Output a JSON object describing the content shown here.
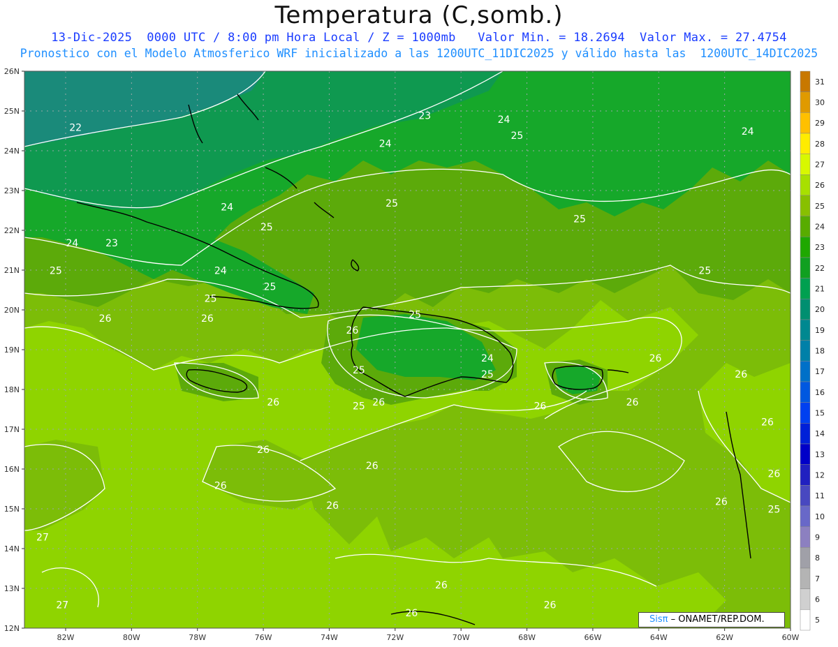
{
  "header": {
    "title": "Temperatura (C,somb.)",
    "line1": "13-Dic-2025  0000 UTC / 8:00 pm Hora Local / Z = 1000mb   Valor Min. = 18.2694  Valor Max. = 27.4754",
    "line2": "Pronostico con el Modelo Atmosferico WRF inicializado a las 1200UTC_11DIC2025 y válido hasta las  1200UTC_14DIC2025"
  },
  "map": {
    "lat_labels": [
      "26N",
      "25N",
      "24N",
      "23N",
      "22N",
      "21N",
      "20N",
      "19N",
      "18N",
      "17N",
      "16N",
      "15N",
      "14N",
      "13N",
      "12N"
    ],
    "lon_labels": [
      "82W",
      "80W",
      "78W",
      "76W",
      "74W",
      "72W",
      "70W",
      "68W",
      "66W",
      "64W",
      "62W",
      "60W"
    ],
    "contour_labels": [
      {
        "text": "23",
        "lon": -71.1,
        "lat": 24.8
      },
      {
        "text": "22",
        "lon": -81.7,
        "lat": 24.5
      },
      {
        "text": "24",
        "lon": -72.3,
        "lat": 24.1
      },
      {
        "text": "24",
        "lon": -68.7,
        "lat": 24.7
      },
      {
        "text": "25",
        "lon": -68.3,
        "lat": 24.3
      },
      {
        "text": "24",
        "lon": -61.3,
        "lat": 24.4
      },
      {
        "text": "24",
        "lon": -77.1,
        "lat": 22.5
      },
      {
        "text": "25",
        "lon": -72.1,
        "lat": 22.6
      },
      {
        "text": "25",
        "lon": -75.9,
        "lat": 22.0
      },
      {
        "text": "25",
        "lon": -66.4,
        "lat": 22.2
      },
      {
        "text": "24",
        "lon": -81.8,
        "lat": 21.6
      },
      {
        "text": "23",
        "lon": -80.6,
        "lat": 21.6
      },
      {
        "text": "24",
        "lon": -77.3,
        "lat": 20.9
      },
      {
        "text": "25",
        "lon": -82.3,
        "lat": 20.9
      },
      {
        "text": "25",
        "lon": -62.6,
        "lat": 20.9
      },
      {
        "text": "25",
        "lon": -75.8,
        "lat": 20.5
      },
      {
        "text": "25",
        "lon": -77.6,
        "lat": 20.2
      },
      {
        "text": "26",
        "lon": -80.8,
        "lat": 19.7
      },
      {
        "text": "26",
        "lon": -77.7,
        "lat": 19.7
      },
      {
        "text": "25",
        "lon": -71.4,
        "lat": 19.8
      },
      {
        "text": "26",
        "lon": -73.3,
        "lat": 19.4
      },
      {
        "text": "24",
        "lon": -69.2,
        "lat": 18.7
      },
      {
        "text": "25",
        "lon": -73.1,
        "lat": 18.4
      },
      {
        "text": "25",
        "lon": -69.2,
        "lat": 18.3
      },
      {
        "text": "26",
        "lon": -64.1,
        "lat": 18.7
      },
      {
        "text": "26",
        "lon": -61.5,
        "lat": 18.3
      },
      {
        "text": "26",
        "lon": -75.7,
        "lat": 17.6
      },
      {
        "text": "25",
        "lon": -73.1,
        "lat": 17.5
      },
      {
        "text": "26",
        "lon": -72.5,
        "lat": 17.6
      },
      {
        "text": "26",
        "lon": -67.6,
        "lat": 17.5
      },
      {
        "text": "26",
        "lon": -64.8,
        "lat": 17.6
      },
      {
        "text": "26",
        "lon": -60.7,
        "lat": 17.1
      },
      {
        "text": "26",
        "lon": -76.0,
        "lat": 16.4
      },
      {
        "text": "26",
        "lon": -72.7,
        "lat": 16.0
      },
      {
        "text": "26",
        "lon": -60.5,
        "lat": 15.8
      },
      {
        "text": "26",
        "lon": -77.3,
        "lat": 15.5
      },
      {
        "text": "26",
        "lon": -73.9,
        "lat": 15.0
      },
      {
        "text": "26",
        "lon": -62.1,
        "lat": 15.1
      },
      {
        "text": "25",
        "lon": -60.5,
        "lat": 14.9
      },
      {
        "text": "27",
        "lon": -82.7,
        "lat": 14.2
      },
      {
        "text": "26",
        "lon": -70.6,
        "lat": 13.0
      },
      {
        "text": "27",
        "lon": -82.1,
        "lat": 12.5
      },
      {
        "text": "26",
        "lon": -71.5,
        "lat": 12.3
      },
      {
        "text": "26",
        "lon": -67.3,
        "lat": 12.5
      }
    ]
  },
  "colorbar": {
    "labels": [
      "31",
      "30",
      "29",
      "28",
      "27",
      "26",
      "25",
      "24",
      "23",
      "22",
      "21",
      "20",
      "19",
      "18",
      "17",
      "16",
      "15",
      "14",
      "13",
      "12",
      "11",
      "10",
      "9",
      "8",
      "7",
      "6",
      "5"
    ],
    "colors": [
      "#c87800",
      "#e09a00",
      "#ffc000",
      "#ffec00",
      "#d8f800",
      "#a8e000",
      "#88c000",
      "#58ac00",
      "#1fa800",
      "#10a020",
      "#00a050",
      "#008f70",
      "#008890",
      "#0080a8",
      "#0070c8",
      "#0058e0",
      "#0040f0",
      "#0020d8",
      "#0000c8",
      "#2020c0",
      "#4848c0",
      "#6868c8",
      "#8c80c0",
      "#a0a0a8",
      "#b4b4b4",
      "#d0d0d0",
      "#ffffff"
    ]
  },
  "fill_colors": {
    "c22": "#1a8a7a",
    "c23": "#0f9950",
    "c24": "#16a82a",
    "c25": "#5caa0a",
    "c26": "#7cbd08",
    "c27": "#8fd400",
    "c28": "#b8ec20",
    "coast": "#000000",
    "contour": "#ffffff",
    "grid": "#9aa8a8"
  },
  "credit": {
    "brand": "Sisπ",
    "text": "– ONAMET/REP.DOM."
  }
}
